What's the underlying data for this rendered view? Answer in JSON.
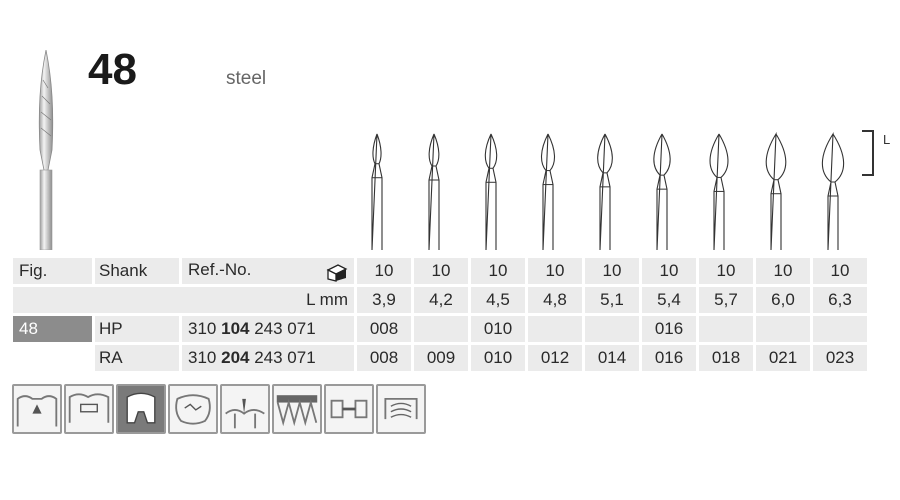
{
  "header": {
    "figure_number": "48",
    "material": "steel"
  },
  "dimension_label": "L",
  "table": {
    "headers": {
      "fig": "Fig.",
      "shank": "Shank",
      "ref": "Ref.-No.",
      "lmm": "L mm"
    },
    "pack_icon": "pack-box-icon",
    "pack_qty": [
      "10",
      "10",
      "10",
      "10",
      "10",
      "10",
      "10",
      "10",
      "10"
    ],
    "lengths": [
      "3,9",
      "4,2",
      "4,5",
      "4,8",
      "5,1",
      "5,4",
      "5,7",
      "6,0",
      "6,3"
    ],
    "rows": [
      {
        "fig": "48",
        "shank": "HP",
        "ref_prefix": "310",
        "ref_bold": "104",
        "ref_suffix": "243 071",
        "sizes": [
          "008",
          "",
          "010",
          "",
          "",
          "016",
          "",
          "",
          ""
        ]
      },
      {
        "fig": "",
        "shank": "RA",
        "ref_prefix": "310",
        "ref_bold": "204",
        "ref_suffix": "243 071",
        "sizes": [
          "008",
          "009",
          "010",
          "012",
          "014",
          "016",
          "018",
          "021",
          "023"
        ]
      }
    ]
  },
  "pictograms": [
    "cavity-prep-icon",
    "crown-prep-icon",
    "bone-surgery-icon",
    "filling-finish-icon",
    "gingiva-icon",
    "teeth-row-icon",
    "bridge-icon",
    "fissure-icon",
    "handpiece-icon"
  ],
  "colors": {
    "cell_bg": "#ebebeb",
    "fig_highlight": "#8c8c8c"
  }
}
